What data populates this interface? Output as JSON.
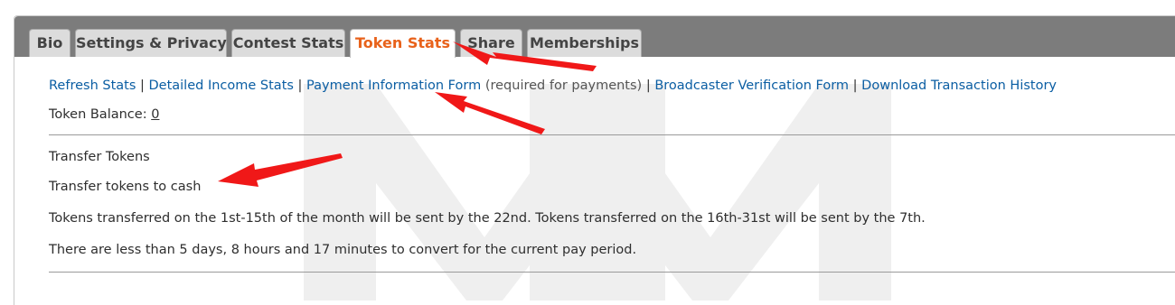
{
  "tabs": [
    {
      "label": "Bio",
      "active": false
    },
    {
      "label": "Settings & Privacy",
      "active": false
    },
    {
      "label": "Contest Stats",
      "active": false
    },
    {
      "label": "Token Stats",
      "active": true
    },
    {
      "label": "Share",
      "active": false
    },
    {
      "label": "Memberships",
      "active": false
    }
  ],
  "links_row": {
    "refresh": "Refresh Stats",
    "detailed": "Detailed Income Stats",
    "payment": "Payment Information Form",
    "payment_note": "(required for payments)",
    "broadcaster": "Broadcaster Verification Form",
    "download": "Download Transaction History",
    "separator": "|"
  },
  "token_balance": {
    "label": "Token Balance:",
    "value": "0"
  },
  "transfer": {
    "heading": "Transfer Tokens",
    "link": "Transfer tokens to cash",
    "schedule": "Tokens transferred on the 1st-15th of the month will be sent by the 22nd. Tokens transferred on the 16th-31st will be sent by the 7th.",
    "deadline": "There are less than 5 days, 8 hours and 17 minutes to convert for the current pay period."
  },
  "colors": {
    "tab_bar": "#7c7c7c",
    "active_tab_text": "#e8621b",
    "link": "#0b5ea3",
    "arrow": "#f01818"
  },
  "annotations": {
    "arrow_color": "#f01818",
    "watermark_text": "MM"
  }
}
